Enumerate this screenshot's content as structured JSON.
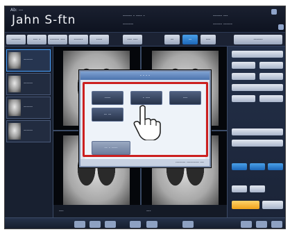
{
  "header": {
    "patient_name": "Jahn S-ftn",
    "info_left": "Ab: ---",
    "info_center_1": "------ - ---- -",
    "info_center_2": "-------",
    "info_right_1": "------ ---",
    "info_right_2": "------ ------"
  },
  "toolbar": {
    "tabs": [
      "------",
      "--- -",
      "------ ---",
      "------",
      "----",
      "--- ---",
      "--",
      "--",
      "---",
      "------"
    ]
  },
  "thumbnails": [
    {
      "label": "------"
    },
    {
      "label": "------"
    },
    {
      "label": "------"
    },
    {
      "label": "------"
    }
  ],
  "viewer": {
    "footer_left": "---",
    "footer_right": "---"
  },
  "dialog": {
    "title": "- - - -",
    "buttons": [
      "----",
      "- ---",
      "---",
      "-- --",
      "-- - ----"
    ],
    "footer": "-------- ---------- ---"
  },
  "colors": {
    "highlight": "#cc1f1f",
    "accent_blue": "#1d67b8",
    "accent_orange": "#f0a21a"
  },
  "icons": {
    "cursor": "pointing-hand-icon"
  }
}
